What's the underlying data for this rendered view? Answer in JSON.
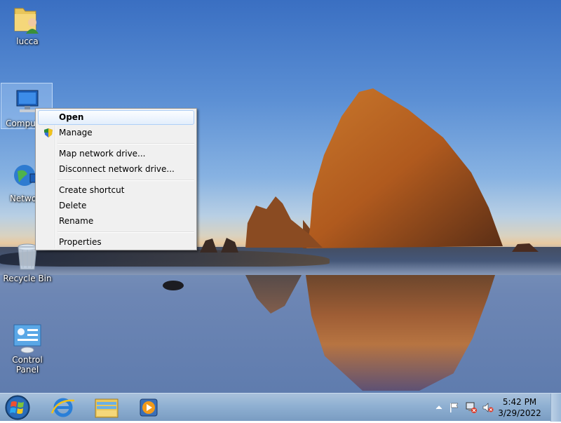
{
  "desktop_icons": {
    "user_folder": {
      "label": "lucca",
      "icon": "user-folder-icon"
    },
    "computer": {
      "label": "Computer",
      "icon": "computer-icon"
    },
    "network": {
      "label": "Network",
      "icon": "network-icon"
    },
    "recycle_bin": {
      "label": "Recycle Bin",
      "icon": "recycle-bin-icon"
    },
    "control_panel": {
      "label": "Control Panel",
      "icon": "control-panel-icon"
    }
  },
  "context_menu": {
    "items": [
      {
        "label": "Open",
        "bold": true,
        "highlighted": true
      },
      {
        "label": "Manage",
        "icon": "uac-shield-icon"
      },
      {
        "label": "Map network drive..."
      },
      {
        "label": "Disconnect network drive..."
      },
      {
        "label": "Create shortcut"
      },
      {
        "label": "Delete"
      },
      {
        "label": "Rename"
      },
      {
        "label": "Properties"
      }
    ]
  },
  "taskbar": {
    "start_icon": "windows-orb-icon",
    "pinned": [
      {
        "name": "Internet Explorer",
        "icon": "internet-explorer-icon"
      },
      {
        "name": "Windows Explorer",
        "icon": "file-explorer-icon"
      },
      {
        "name": "Windows Media Player",
        "icon": "media-player-icon"
      }
    ],
    "tray_icons": [
      "show-hidden-icons-chevron",
      "action-center-flag-icon",
      "network-error-icon",
      "volume-muted-icon"
    ],
    "clock": {
      "time": "5:42 PM",
      "date": "3/29/2022"
    }
  },
  "colors": {
    "taskbar": "#8fb0d2",
    "menu_bg": "#f0f0f0",
    "menu_highlight_border": "#aecff7"
  }
}
